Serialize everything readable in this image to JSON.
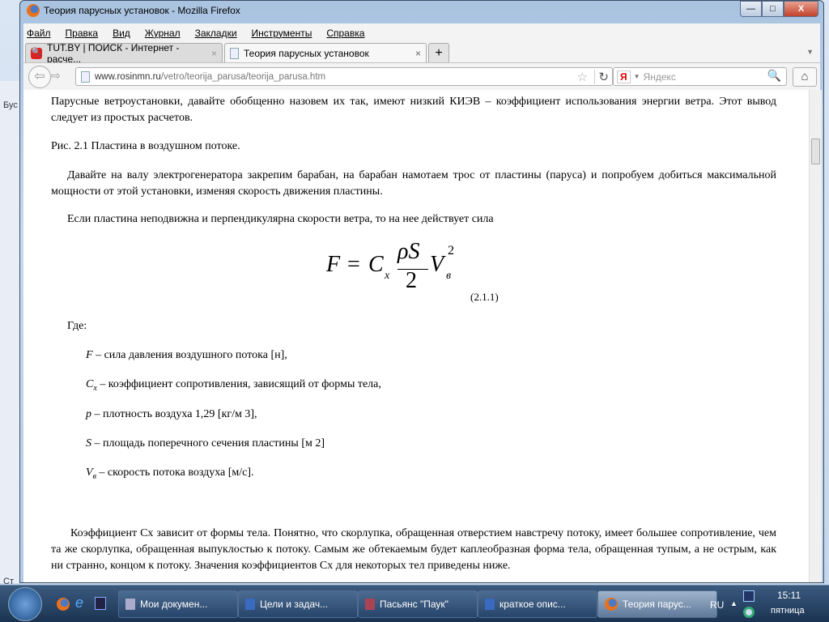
{
  "window": {
    "title": "Теория парусных установок - Mozilla Firefox",
    "minimize": "—",
    "maximize": "□",
    "close": "X"
  },
  "background_app": {
    "fragments": [
      "Бус",
      "Ст"
    ]
  },
  "menu": [
    "Файл",
    "Правка",
    "Вид",
    "Журнал",
    "Закладки",
    "Инструменты",
    "Справка"
  ],
  "tabs": [
    {
      "label": "TUT.BY | ПОИСК - Интернет - расче...",
      "close": "×"
    },
    {
      "label": "Теория парусных установок",
      "close": "×"
    }
  ],
  "new_tab": "+",
  "url": {
    "domain": "www.rosinmn.ru",
    "path": "/vetro/teorija_parusa/teorija_parusa.htm"
  },
  "search": {
    "placeholder": "Яндекс",
    "engine": "Я"
  },
  "content": {
    "p1": "Парусные ветроустановки, давайте обобщенно назовем их так, имеют низкий КИЭВ – коэффициент использования энергии ветра. Этот вывод следует из простых расчетов.",
    "fig": "Рис. 2.1 Пластина в воздушном потоке.",
    "p2": "Давайте на валу электрогенератора закрепим барабан, на барабан намотаем трос от пластины (паруса) и попробуем добиться максимальной мощности от этой установки, изменяя скорость движения пластины.",
    "p3": "Если пластина неподвижна и перпендикулярна скорости ветра, то на нее действует сила",
    "formula": {
      "lhs": "F",
      "eq": "=",
      "c": "C",
      "cx": "x",
      "num": "ρS",
      "den": "2",
      "v": "V",
      "vsub": "в",
      "exp": "2",
      "number": "(2.1.1)"
    },
    "where": "Где:",
    "defs": [
      {
        "sym": "F",
        "sub": "",
        "text": " – сила давления воздушного потока [н],"
      },
      {
        "sym": "C",
        "sub": "x",
        "text": " – коэффициент сопротивления, зависящий от формы тела,"
      },
      {
        "sym": "p",
        "sub": "",
        "text": " – плотность воздуха 1,29 [кг/м 3],"
      },
      {
        "sym": "S",
        "sub": "",
        "text": " – площадь поперечного сечения пластины [м 2]"
      },
      {
        "sym": "V",
        "sub": "в",
        "text": " – скорость потока воздуха [м/с]."
      }
    ],
    "p4": "Коэффициент Cх зависит от формы тела. Понятно, что скорлупка, обращенная отверстием навстречу потоку, имеет большее сопротивление, чем та же скорлупка, обращенная выпуклостью к потоку. Самым же обтекаемым будет каплеобразная форма тела, обращенная тупым, а не острым, как ни странно, концом к потоку. Значения коэффициентов Cх для некоторых тел приведены ниже."
  },
  "taskbar": {
    "items": [
      "Мои докумен...",
      "Цели и задач...",
      "Пасьянс \"Паук\"",
      "краткое опис...",
      "Теория парус..."
    ],
    "lang": "RU",
    "time": "15:11",
    "day": "пятница"
  }
}
